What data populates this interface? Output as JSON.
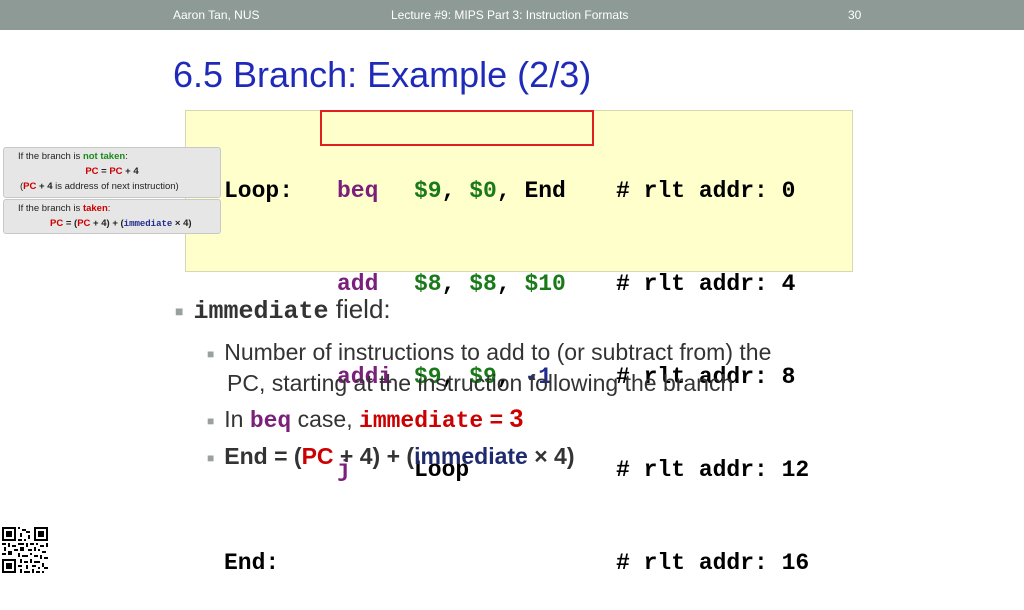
{
  "header": {
    "author": "Aaron Tan, NUS",
    "lecture": "Lecture #9: MIPS Part 3: Instruction Formats",
    "page": "30"
  },
  "title": "6.5 Branch: Example (2/3)",
  "code": {
    "lines": [
      {
        "label": "Loop:",
        "op": "beq",
        "a1": "$9",
        "a2": "$0",
        "a3": "End",
        "comment": "# rlt addr: 0"
      },
      {
        "label": "",
        "op": "add",
        "a1": "$8",
        "a2": "$8",
        "a3": "$10",
        "comment": "# rlt addr: 4"
      },
      {
        "label": "",
        "op": "addi",
        "a1": "$9",
        "a2": "$9",
        "a3": "-1",
        "comment": "# rlt addr: 8"
      },
      {
        "label": "",
        "op": "j",
        "a1": "Loop",
        "a2": "",
        "a3": "",
        "comment": "# rlt addr: 12"
      },
      {
        "label": "End:",
        "op": "",
        "a1": "",
        "a2": "",
        "a3": "",
        "comment": "# rlt addr: 16"
      }
    ]
  },
  "notes": {
    "not_taken": {
      "l1_pre": "If the branch is ",
      "l1_em": "not taken",
      "l1_post": ":",
      "l2_pc1": "PC",
      "l2_mid": " = ",
      "l2_pc2": "PC",
      "l2_post": " + 4",
      "l3_open": "(",
      "l3_pc": "PC",
      "l3_plus": " + 4",
      "l3_post": " is  address of next instruction)"
    },
    "taken": {
      "l1_pre": "If the branch is ",
      "l1_em": "taken",
      "l1_post": ":",
      "l2_pc1": "PC",
      "l2_mid": " = (",
      "l2_pc2": "PC",
      "l2_mid2": " + 4) + (",
      "l2_imm": "immediate",
      "l2_post": " × 4)"
    }
  },
  "bullets": {
    "b1_mono": "immediate",
    "b1_text": " field:",
    "b2_line1": "Number of instructions to add to (or subtract from) the",
    "b2_line2": "PC, starting at the instruction following the branch",
    "b3_pre": "In ",
    "b3_beq": "beq",
    "b3_mid": " case, ",
    "b3_imm": "immediate",
    "b3_eq": " = ",
    "b3_val": "3",
    "b4_end": "End",
    "b4_eq": " = (",
    "b4_pc": "PC",
    "b4_plus": " + 4) + (",
    "b4_imm": "immediate",
    "b4_post": " × 4)"
  },
  "colors": {
    "title": "#1f2bb8",
    "opcode": "#7a1f7a",
    "register": "#1a7a1a",
    "number": "#1f2b8f",
    "highlight_box": "#e02020",
    "code_bg": "#ffffcc",
    "header_bg": "#8e9a95"
  },
  "icons": {
    "qr": "qr-code-icon",
    "bullet": "square-bullet-icon"
  }
}
